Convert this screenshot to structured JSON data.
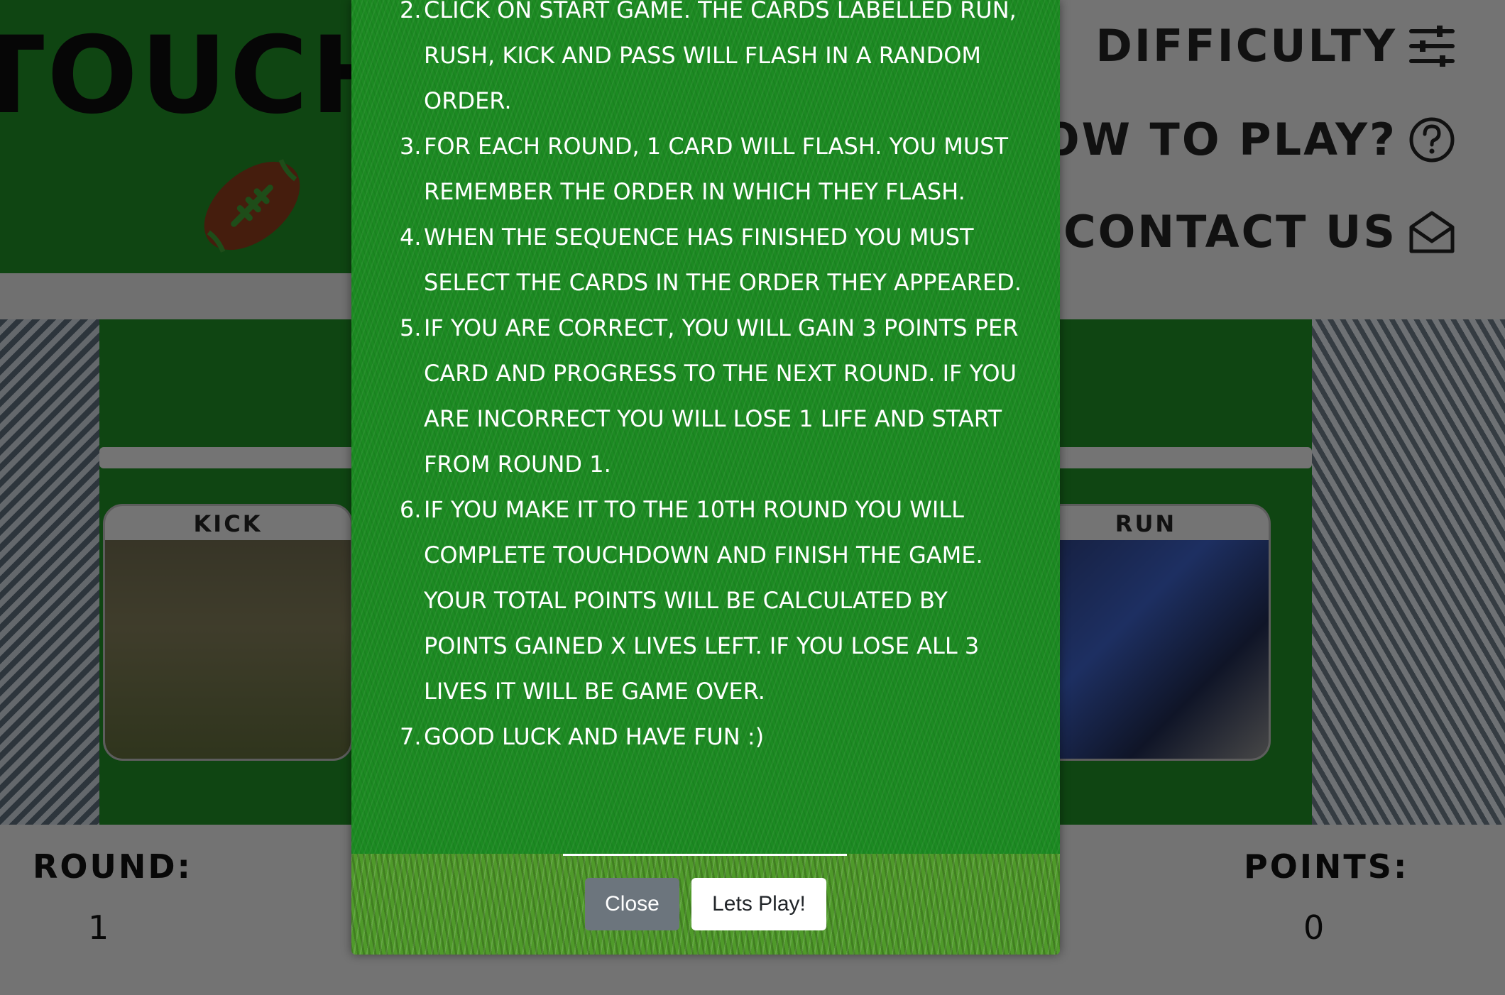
{
  "header": {
    "title": "TOUCHDOWN",
    "nav": {
      "difficulty": "DIFFICULTY",
      "how_to_play": "HOW TO PLAY?",
      "contact": "CONTACT US"
    }
  },
  "cards": {
    "left_label": "KICK",
    "right_label": "RUN"
  },
  "stats": {
    "round_label": "ROUND:",
    "round_value": "1",
    "points_label": "POINTS:",
    "points_value": "0"
  },
  "modal": {
    "rules": [
      {
        "num": "2.",
        "text": "CLICK ON START GAME. THE CARDS LABELLED RUN, RUSH, KICK AND PASS WILL FLASH IN A RANDOM ORDER."
      },
      {
        "num": "3.",
        "text": "FOR EACH ROUND, 1 CARD WILL FLASH. YOU MUST REMEMBER THE ORDER IN WHICH THEY FLASH."
      },
      {
        "num": "4.",
        "text": "WHEN THE SEQUENCE HAS FINISHED YOU MUST SELECT THE CARDS IN THE ORDER THEY APPEARED."
      },
      {
        "num": "5.",
        "text": "IF YOU ARE CORRECT, YOU WILL GAIN 3 POINTS PER CARD AND PROGRESS TO THE NEXT ROUND. IF YOU ARE INCORRECT YOU WILL LOSE 1 LIFE AND START FROM ROUND 1."
      },
      {
        "num": "6.",
        "text": "IF YOU MAKE IT TO THE 10TH ROUND YOU WILL COMPLETE TOUCHDOWN AND FINISH THE GAME. YOUR TOTAL POINTS WILL BE CALCULATED BY POINTS GAINED X LIVES LEFT. IF YOU LOSE ALL 3 LIVES IT WILL BE GAME OVER."
      },
      {
        "num": "7.",
        "text": "GOOD LUCK AND HAVE FUN :)"
      }
    ],
    "close_label": "Close",
    "play_label": "Lets Play!"
  },
  "colors": {
    "field_green": "#1f8a24",
    "football_brown": "#8b3a1a",
    "button_gray": "#6c757d"
  },
  "icons": [
    "football-icon",
    "sliders-icon",
    "question-circle-icon",
    "envelope-open-icon"
  ]
}
